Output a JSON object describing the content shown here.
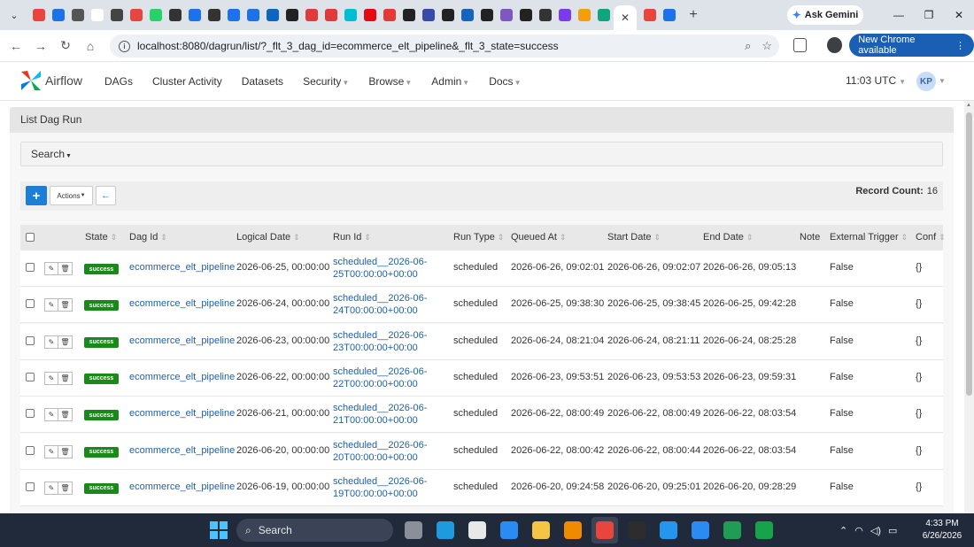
{
  "browser": {
    "tab_close_glyph": "✕",
    "new_tab_glyph": "+",
    "gemini_label": "Ask Gemini",
    "url": "localhost:8080/dagrun/list/?_flt_3_dag_id=ecommerce_elt_pipeline&_flt_3_state=success",
    "new_chrome_label": "New Chrome available",
    "favicon_colors": [
      "#e8453c",
      "#1a73e8",
      "#555555",
      "#ffffff",
      "#444444",
      "#e8453c",
      "#25d366",
      "#333333",
      "#1a73e8",
      "#333333",
      "#1a73e8",
      "#1a73e8",
      "#0a66c2",
      "#222222",
      "#e03a3a",
      "#e03a3a",
      "#00bcd4",
      "#e50914",
      "#e53935",
      "#222222",
      "#3949ab",
      "#222222",
      "#1565c0",
      "#222222",
      "#7e57c2",
      "#222222",
      "#333333",
      "#7c3aed",
      "#f59e0b",
      "#12a37f",
      "#e8453c",
      "#1a73e8"
    ]
  },
  "airflow": {
    "brand": "Airflow",
    "menu": [
      {
        "label": "DAGs",
        "dropdown": false
      },
      {
        "label": "Cluster Activity",
        "dropdown": false
      },
      {
        "label": "Datasets",
        "dropdown": false
      },
      {
        "label": "Security",
        "dropdown": true
      },
      {
        "label": "Browse",
        "dropdown": true
      },
      {
        "label": "Admin",
        "dropdown": true
      },
      {
        "label": "Docs",
        "dropdown": true
      }
    ],
    "time": "11:03 UTC",
    "user_initials": "KP"
  },
  "page": {
    "title": "List Dag Run",
    "search_label": "Search",
    "add_glyph": "+",
    "actions_label": "Actions",
    "back_glyph": "←",
    "record_count_label": "Record Count:",
    "record_count": "16"
  },
  "table": {
    "columns": [
      "State",
      "Dag Id",
      "Logical Date",
      "Run Id",
      "Run Type",
      "Queued At",
      "Start Date",
      "End Date",
      "Note",
      "External Trigger",
      "Conf"
    ],
    "rows": [
      {
        "state": "success",
        "dag_id": "ecommerce_elt_pipeline",
        "logical_date": "2026-06-25, 00:00:00",
        "run_id_1": "scheduled__2026-06-",
        "run_id_2": "25T00:00:00+00:00",
        "run_type": "scheduled",
        "queued_at": "2026-06-26, 09:02:01",
        "start_date": "2026-06-26, 09:02:07",
        "end_date": "2026-06-26, 09:05:13",
        "note": "",
        "external_trigger": "False",
        "conf": "{}"
      },
      {
        "state": "success",
        "dag_id": "ecommerce_elt_pipeline",
        "logical_date": "2026-06-24, 00:00:00",
        "run_id_1": "scheduled__2026-06-",
        "run_id_2": "24T00:00:00+00:00",
        "run_type": "scheduled",
        "queued_at": "2026-06-25, 09:38:30",
        "start_date": "2026-06-25, 09:38:45",
        "end_date": "2026-06-25, 09:42:28",
        "note": "",
        "external_trigger": "False",
        "conf": "{}"
      },
      {
        "state": "success",
        "dag_id": "ecommerce_elt_pipeline",
        "logical_date": "2026-06-23, 00:00:00",
        "run_id_1": "scheduled__2026-06-",
        "run_id_2": "23T00:00:00+00:00",
        "run_type": "scheduled",
        "queued_at": "2026-06-24, 08:21:04",
        "start_date": "2026-06-24, 08:21:11",
        "end_date": "2026-06-24, 08:25:28",
        "note": "",
        "external_trigger": "False",
        "conf": "{}"
      },
      {
        "state": "success",
        "dag_id": "ecommerce_elt_pipeline",
        "logical_date": "2026-06-22, 00:00:00",
        "run_id_1": "scheduled__2026-06-",
        "run_id_2": "22T00:00:00+00:00",
        "run_type": "scheduled",
        "queued_at": "2026-06-23, 09:53:51",
        "start_date": "2026-06-23, 09:53:53",
        "end_date": "2026-06-23, 09:59:31",
        "note": "",
        "external_trigger": "False",
        "conf": "{}"
      },
      {
        "state": "success",
        "dag_id": "ecommerce_elt_pipeline",
        "logical_date": "2026-06-21, 00:00:00",
        "run_id_1": "scheduled__2026-06-",
        "run_id_2": "21T00:00:00+00:00",
        "run_type": "scheduled",
        "queued_at": "2026-06-22, 08:00:49",
        "start_date": "2026-06-22, 08:00:49",
        "end_date": "2026-06-22, 08:03:54",
        "note": "",
        "external_trigger": "False",
        "conf": "{}"
      },
      {
        "state": "success",
        "dag_id": "ecommerce_elt_pipeline",
        "logical_date": "2026-06-20, 00:00:00",
        "run_id_1": "scheduled__2026-06-",
        "run_id_2": "20T00:00:00+00:00",
        "run_type": "scheduled",
        "queued_at": "2026-06-22, 08:00:42",
        "start_date": "2026-06-22, 08:00:44",
        "end_date": "2026-06-22, 08:03:54",
        "note": "",
        "external_trigger": "False",
        "conf": "{}"
      },
      {
        "state": "success",
        "dag_id": "ecommerce_elt_pipeline",
        "logical_date": "2026-06-19, 00:00:00",
        "run_id_1": "scheduled__2026-06-",
        "run_id_2": "19T00:00:00+00:00",
        "run_type": "scheduled",
        "queued_at": "2026-06-20, 09:24:58",
        "start_date": "2026-06-20, 09:25:01",
        "end_date": "2026-06-20, 09:28:29",
        "note": "",
        "external_trigger": "False",
        "conf": "{}"
      }
    ]
  },
  "taskbar": {
    "search_label": "Search",
    "apps": [
      {
        "name": "file-explorer",
        "color": "#8a8f99",
        "active": false
      },
      {
        "name": "edge",
        "color": "#1e9be0",
        "active": false
      },
      {
        "name": "store",
        "color": "#e8e8e8",
        "active": false
      },
      {
        "name": "mail",
        "color": "#2a8bf2",
        "active": false
      },
      {
        "name": "folder",
        "color": "#f6c445",
        "active": false
      },
      {
        "name": "vlc",
        "color": "#f08a00",
        "active": false
      },
      {
        "name": "chrome",
        "color": "#e8453c",
        "active": true
      },
      {
        "name": "terminal",
        "color": "#2d2d2d",
        "active": false
      },
      {
        "name": "docker",
        "color": "#2496ed",
        "active": false
      },
      {
        "name": "vscode",
        "color": "#2a8bf2",
        "active": false
      },
      {
        "name": "excel",
        "color": "#1f9d55",
        "active": false
      },
      {
        "name": "green-app",
        "color": "#16a34a",
        "active": false
      }
    ],
    "time": "4:33 PM",
    "date": "6/26/2026"
  }
}
